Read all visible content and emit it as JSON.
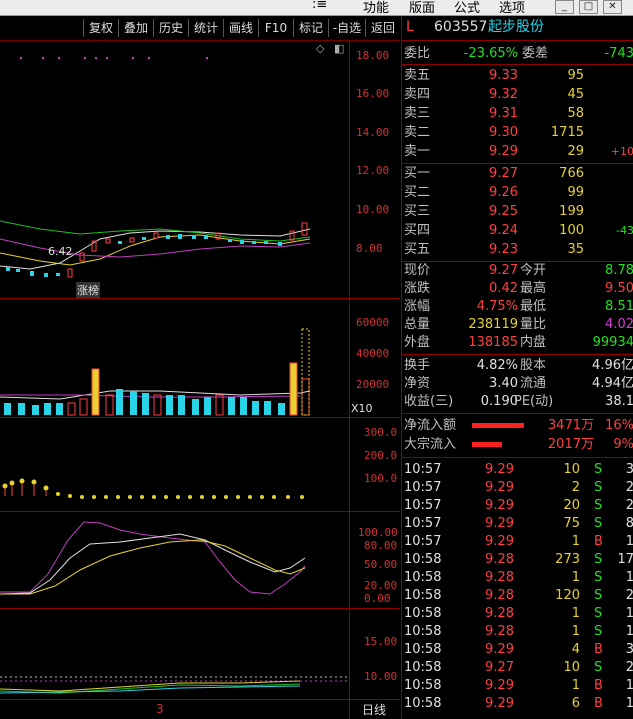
{
  "menu": {
    "items": [
      "功能",
      "版面",
      "公式",
      "选项"
    ],
    "window_buttons": [
      "_",
      "□",
      "✕"
    ],
    "leading_icon": ":≡"
  },
  "toolbar": {
    "buttons": [
      "复权",
      "叠加",
      "历史",
      "统计",
      "画线",
      "F10",
      "标记",
      "-自选",
      "返回"
    ]
  },
  "chart": {
    "price_axis": [
      "18.00",
      "16.00",
      "14.00",
      "12.00",
      "10.00",
      "8.00"
    ],
    "low_label": "6.42",
    "tag_label": "涨榜",
    "volume_axis": [
      "60000",
      "40000",
      "20000"
    ],
    "volume_unit": "X10",
    "ind1_axis": [
      "300.0",
      "200.0",
      "100.0"
    ],
    "kdj_axis": [
      "100.00",
      "80.00",
      "50.00",
      "20.00",
      "0.00"
    ],
    "ind3_axis": [
      "15.00",
      "10.00"
    ],
    "bottom_marker": "3",
    "period_label": "日线"
  },
  "quote": {
    "prefix": "L",
    "code": "603557",
    "name": "起步股份",
    "weibi_label": "委比",
    "weibi_value": "-23.65%",
    "weicha_label": "委差",
    "weicha_value": "-743",
    "sell": [
      {
        "label": "卖五",
        "price": "9.33",
        "vol": "95",
        "chg": ""
      },
      {
        "label": "卖四",
        "price": "9.32",
        "vol": "45",
        "chg": ""
      },
      {
        "label": "卖三",
        "price": "9.31",
        "vol": "58",
        "chg": ""
      },
      {
        "label": "卖二",
        "price": "9.30",
        "vol": "1715",
        "chg": ""
      },
      {
        "label": "卖一",
        "price": "9.29",
        "vol": "29",
        "chg": "+10"
      }
    ],
    "buy": [
      {
        "label": "买一",
        "price": "9.27",
        "vol": "766",
        "chg": ""
      },
      {
        "label": "买二",
        "price": "9.26",
        "vol": "99",
        "chg": ""
      },
      {
        "label": "买三",
        "price": "9.25",
        "vol": "199",
        "chg": ""
      },
      {
        "label": "买四",
        "price": "9.24",
        "vol": "100",
        "chg": "-43"
      },
      {
        "label": "买五",
        "price": "9.23",
        "vol": "35",
        "chg": ""
      }
    ],
    "stats": [
      {
        "l1": "现价",
        "v1": "9.27",
        "l2": "今开",
        "v2": "8.78"
      },
      {
        "l1": "涨跌",
        "v1": "0.42",
        "l2": "最高",
        "v2": "9.50"
      },
      {
        "l1": "涨幅",
        "v1": "4.75%",
        "l2": "最低",
        "v2": "8.51"
      },
      {
        "l1": "总量",
        "v1": "238119",
        "l2": "量比",
        "v2": "4.02"
      },
      {
        "l1": "外盘",
        "v1": "138185",
        "l2": "内盘",
        "v2": "99934"
      }
    ],
    "stats2": [
      {
        "l1": "换手",
        "v1": "4.82%",
        "l2": "股本",
        "v2": "4.96亿"
      },
      {
        "l1": "净资",
        "v1": "3.40",
        "l2": "流通",
        "v2": "4.94亿"
      },
      {
        "l1": "收益(三)",
        "v1": "0.190",
        "l2": "PE(动)",
        "v2": "38.1"
      }
    ],
    "flow": [
      {
        "label": "净流入额",
        "value": "3471万",
        "pct": "16%"
      },
      {
        "label": "大宗流入",
        "value": "2017万",
        "pct": "9%"
      }
    ],
    "ticks": [
      {
        "t": "10:57",
        "p": "9.29",
        "v": "10",
        "s": "S",
        "n": "3"
      },
      {
        "t": "10:57",
        "p": "9.29",
        "v": "2",
        "s": "S",
        "n": "2"
      },
      {
        "t": "10:57",
        "p": "9.29",
        "v": "20",
        "s": "S",
        "n": "2"
      },
      {
        "t": "10:57",
        "p": "9.29",
        "v": "75",
        "s": "S",
        "n": "8"
      },
      {
        "t": "10:57",
        "p": "9.29",
        "v": "1",
        "s": "B",
        "n": "1"
      },
      {
        "t": "10:58",
        "p": "9.28",
        "v": "273",
        "s": "S",
        "n": "17"
      },
      {
        "t": "10:58",
        "p": "9.28",
        "v": "1",
        "s": "S",
        "n": "1"
      },
      {
        "t": "10:58",
        "p": "9.28",
        "v": "120",
        "s": "S",
        "n": "2"
      },
      {
        "t": "10:58",
        "p": "9.28",
        "v": "1",
        "s": "S",
        "n": "1"
      },
      {
        "t": "10:58",
        "p": "9.28",
        "v": "1",
        "s": "S",
        "n": "1"
      },
      {
        "t": "10:58",
        "p": "9.29",
        "v": "4",
        "s": "B",
        "n": "3"
      },
      {
        "t": "10:58",
        "p": "9.27",
        "v": "10",
        "s": "S",
        "n": "2"
      },
      {
        "t": "10:58",
        "p": "9.29",
        "v": "1",
        "s": "B",
        "n": "1"
      },
      {
        "t": "10:58",
        "p": "9.29",
        "v": "6",
        "s": "B",
        "n": "1"
      }
    ]
  }
}
